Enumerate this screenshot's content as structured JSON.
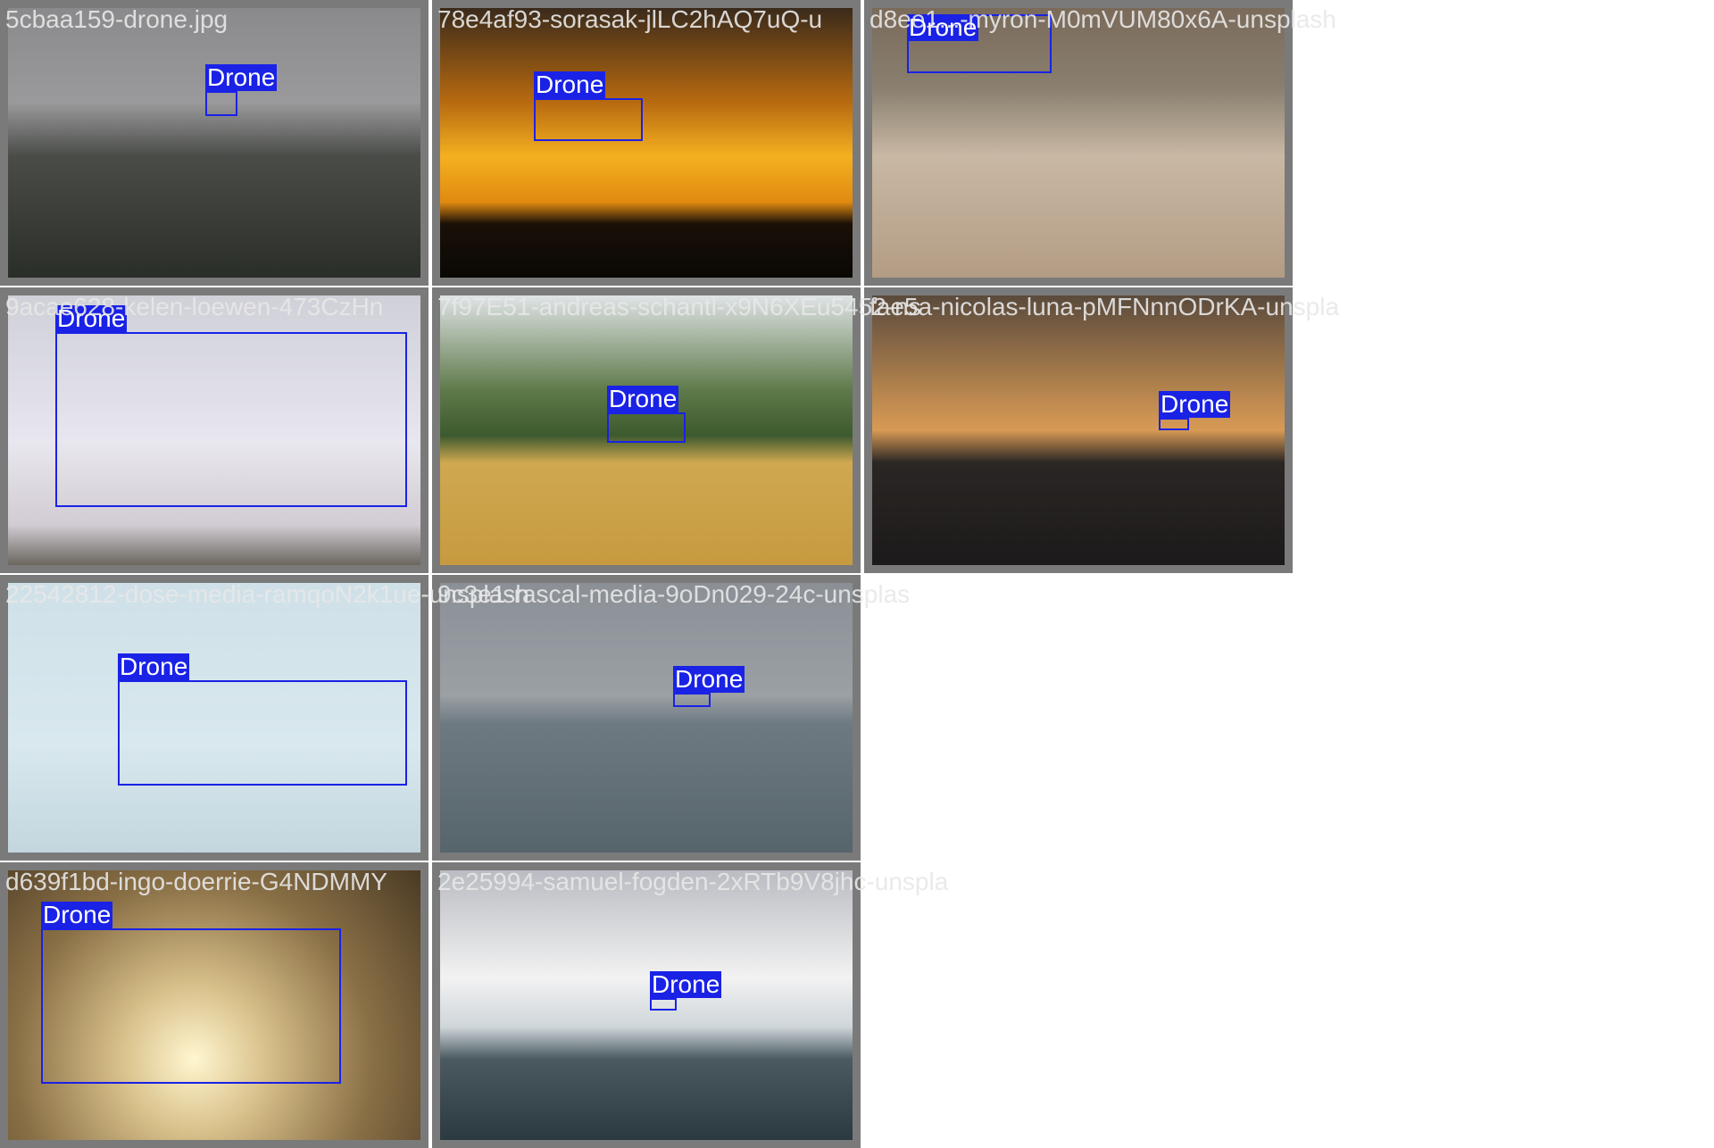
{
  "tiles": [
    {
      "file": "5cbaa159-drone.jpg",
      "label": "Drone",
      "bg": "linear-gradient(180deg,#8a8a8c 0%,#9a9a9c 35%,#4a4c48 55%,#2a2e28 100%)",
      "glow": "#ffffff"
    },
    {
      "file": "78e4af93-sorasak-jlLC2hAQ7uQ-u",
      "label": "Drone",
      "bg": "linear-gradient(180deg,#3a2a1a 0%,#b86a10 35%,#f5b020 55%,#e08a10 72%,#1a1008 80%,#0a0804 100%)",
      "glow": "#fff2a0"
    },
    {
      "file": "d8ee1...-myron-M0mVUM80x6A-unsplash",
      "label": "Drone",
      "bg": "linear-gradient(180deg,#7a6a5a 0%,#8a8070 30%,#c9b8a4 55%,#b39c84 100%)",
      "glow": ""
    },
    {
      "file": "9acae628-kelen-loewen-473CzHn",
      "label": "Drone",
      "bg": "linear-gradient(180deg,#cfd0d8 0%,#e8e6ee 55%,#d2ccd4 85%,#6a665e 100%)",
      "glow": ""
    },
    {
      "file": "7f97E51-andreas-schantl-x9N6XEu5452-ns",
      "label": "Drone",
      "bg": "linear-gradient(180deg,#dfe4e6 0%,#5f7a4a 35%,#3d5a2e 52%,#cfa850 62%,#c79a40 100%)",
      "glow": ""
    },
    {
      "file": "fae5a-nicolas-luna-pMFNnnODrKA-unspla",
      "label": "Drone",
      "bg": "linear-gradient(180deg,#5a4a3c 0%,#c08b50 40%,#d89a55 50%,#2a2624 62%,#1c1a1a 100%)",
      "glow": "#ffe6a0"
    },
    {
      "file": "22542812-dose-media-ramqoN2k1ue-unsplash",
      "label": "Drone",
      "bg": "linear-gradient(180deg,#cfe0e8 0%,#d8e8ee 60%,#c3d6de 100%)",
      "glow": ""
    },
    {
      "file": "9c3e1-rascal-media-9oDn029-24c-unsplas",
      "label": "Drone",
      "bg": "linear-gradient(180deg,#8a9096 0%,#9aa0a4 42%,#6e7a82 52%,#56646c 100%)",
      "glow": ""
    },
    {
      "file": "d639f1bd-ingo-doerrie-G4NDMMY",
      "label": "Drone",
      "bg": "radial-gradient(circle at 45% 70%, #fff6d0 0%, #d8c08a 25%, #8a7046 60%, #4a3a24 100%)",
      "glow": ""
    },
    {
      "file": "2e25994-samuel-fogden-2xRTb9V8jhc-unspla",
      "label": "Drone",
      "bg": "linear-gradient(180deg,#b9bcc2 0%,#f2f2f2 40%,#cfd6da 58%,#4a5a60 70%,#2a3a40 100%)",
      "glow": "#ffffff"
    }
  ]
}
